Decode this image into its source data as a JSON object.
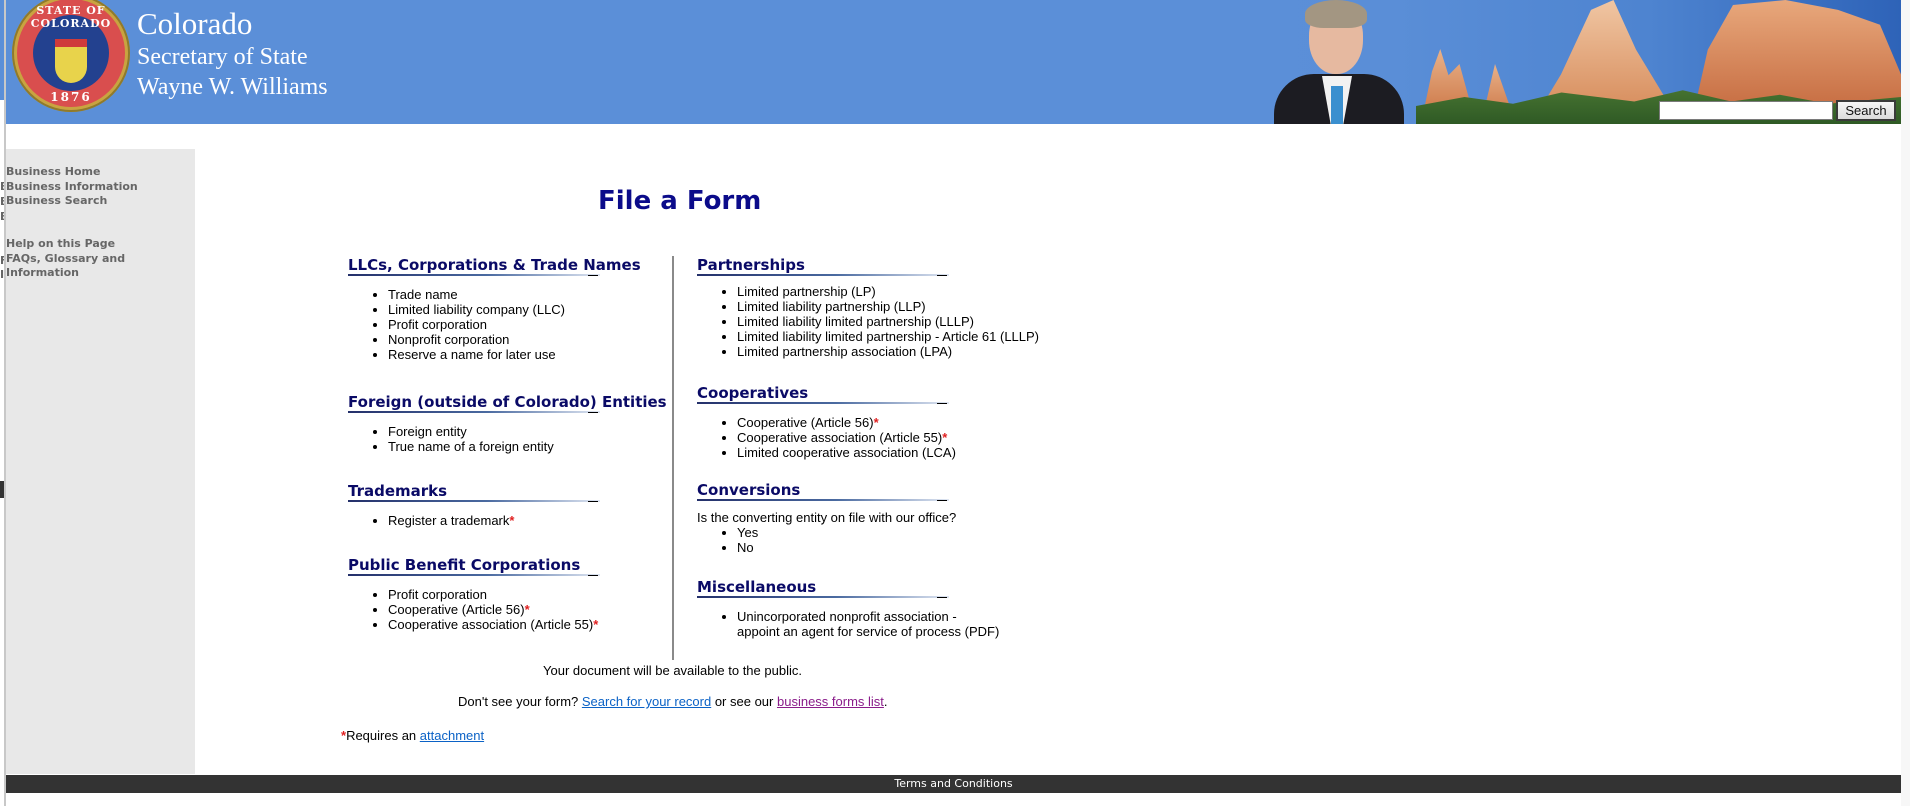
{
  "header": {
    "state": "Colorado",
    "office": "Secretary of State",
    "official": "Wayne W. Williams",
    "seal": {
      "top_text": "STATE OF COLORADO",
      "year": "1876"
    },
    "search": {
      "value": "",
      "placeholder": "",
      "button_label": "Search"
    }
  },
  "sidebar": {
    "left_fragments": [
      "B",
      "B",
      "B",
      "F",
      "I"
    ],
    "group1": [
      {
        "label": "Business Home"
      },
      {
        "label": "Business Information"
      },
      {
        "label": "Business Search"
      }
    ],
    "group2": [
      {
        "label": "Help on this Page"
      },
      {
        "label": "FAQs, Glossary and"
      },
      {
        "label": "Information"
      }
    ]
  },
  "main": {
    "title": "File a Form",
    "left_sections": [
      {
        "heading": "LLCs, Corporations & Trade Names",
        "items": [
          {
            "label": "Trade name",
            "required": false
          },
          {
            "label": "Limited liability company (LLC)",
            "required": false
          },
          {
            "label": "Profit corporation",
            "required": false
          },
          {
            "label": "Nonprofit corporation",
            "required": false
          },
          {
            "label": "Reserve a name for later use",
            "required": false
          }
        ]
      },
      {
        "heading": "Foreign (outside of Colorado) Entities",
        "items": [
          {
            "label": "Foreign entity",
            "required": false
          },
          {
            "label": "True name of a foreign entity",
            "required": false
          }
        ]
      },
      {
        "heading": "Trademarks",
        "items": [
          {
            "label": "Register a trademark",
            "required": true
          }
        ]
      },
      {
        "heading": "Public Benefit Corporations",
        "items": [
          {
            "label": "Profit corporation",
            "required": false
          },
          {
            "label": "Cooperative (Article 56)",
            "required": true
          },
          {
            "label": "Cooperative association (Article 55)",
            "required": true
          }
        ]
      }
    ],
    "right_sections": [
      {
        "heading": "Partnerships",
        "items": [
          {
            "label": "Limited partnership (LP)",
            "required": false
          },
          {
            "label": "Limited liability partnership (LLP)",
            "required": false
          },
          {
            "label": "Limited liability limited partnership (LLLP)",
            "required": false
          },
          {
            "label": "Limited liability limited partnership - Article 61 (LLLP)",
            "required": false
          },
          {
            "label": "Limited partnership association (LPA)",
            "required": false
          }
        ]
      },
      {
        "heading": "Cooperatives",
        "items": [
          {
            "label": "Cooperative (Article 56)",
            "required": true
          },
          {
            "label": "Cooperative association (Article 55)",
            "required": true
          },
          {
            "label": "Limited cooperative association (LCA)",
            "required": false
          }
        ]
      },
      {
        "heading": "Conversions",
        "question": "Is the converting entity on file with our office?",
        "items": [
          {
            "label": "Yes",
            "required": false
          },
          {
            "label": "No",
            "required": false
          }
        ]
      },
      {
        "heading": "Miscellaneous",
        "items": [
          {
            "label": "Unincorporated nonprofit association -",
            "label2": "appoint an agent for service of process (PDF)",
            "required": false
          }
        ]
      }
    ],
    "public_notice": "Your document will be available to the public.",
    "dont_see": {
      "prefix": "Don't see your form? ",
      "link1": "Search for your record",
      "middle": " or see our ",
      "link2": "business forms list",
      "suffix": "."
    },
    "requires": {
      "asterisk": "*",
      "text": "Requires an ",
      "link": "attachment"
    }
  },
  "footer": {
    "terms": "Terms and Conditions"
  },
  "colors": {
    "header_blue": "#5b8fd8",
    "title_navy": "#0b0b8a",
    "heading_navy": "#0a0a66",
    "link_blue": "#0b62c6",
    "link_visited": "#8a1c8a",
    "required_red": "#e02020",
    "sidebar_gray": "#e8e8e8",
    "footer_dark": "#333333"
  }
}
